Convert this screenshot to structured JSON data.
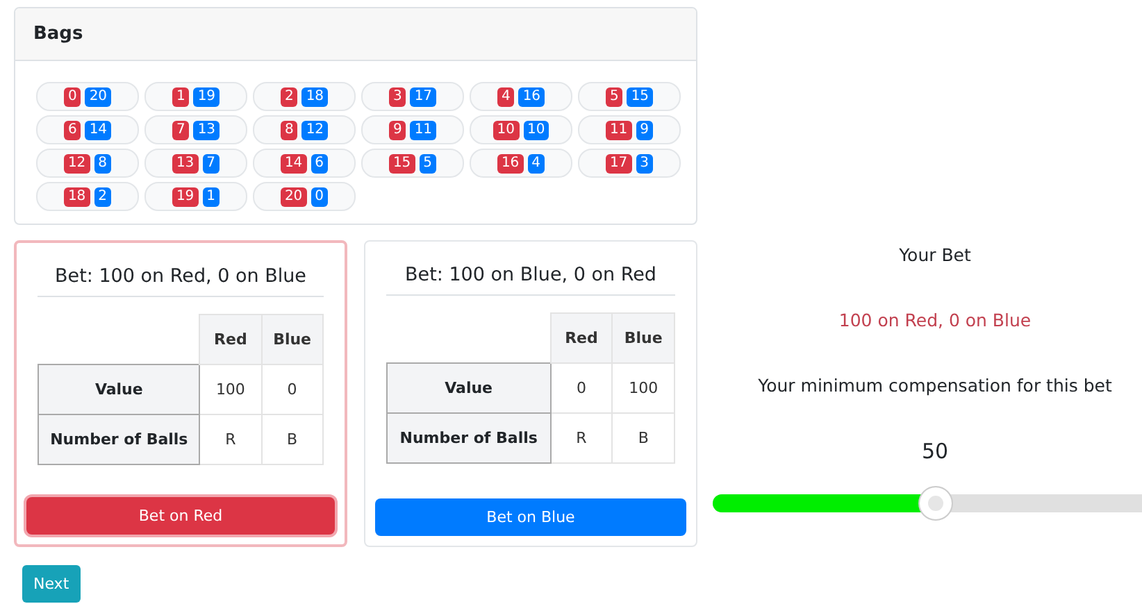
{
  "bags_panel": {
    "title": "Bags",
    "bags": [
      {
        "red": "0",
        "blue": "20"
      },
      {
        "red": "1",
        "blue": "19"
      },
      {
        "red": "2",
        "blue": "18"
      },
      {
        "red": "3",
        "blue": "17"
      },
      {
        "red": "4",
        "blue": "16"
      },
      {
        "red": "5",
        "blue": "15"
      },
      {
        "red": "6",
        "blue": "14"
      },
      {
        "red": "7",
        "blue": "13"
      },
      {
        "red": "8",
        "blue": "12"
      },
      {
        "red": "9",
        "blue": "11"
      },
      {
        "red": "10",
        "blue": "10"
      },
      {
        "red": "11",
        "blue": "9"
      },
      {
        "red": "12",
        "blue": "8"
      },
      {
        "red": "13",
        "blue": "7"
      },
      {
        "red": "14",
        "blue": "6"
      },
      {
        "red": "15",
        "blue": "5"
      },
      {
        "red": "16",
        "blue": "4"
      },
      {
        "red": "17",
        "blue": "3"
      },
      {
        "red": "18",
        "blue": "2"
      },
      {
        "red": "19",
        "blue": "1"
      },
      {
        "red": "20",
        "blue": "0"
      }
    ]
  },
  "bet_cards": [
    {
      "title": "Bet: 100 on Red, 0 on Blue",
      "selected": true,
      "columns": [
        "Red",
        "Blue"
      ],
      "rows": [
        {
          "label": "Value",
          "cells": [
            "100",
            "0"
          ]
        },
        {
          "label": "Number of Balls",
          "cells": [
            "R",
            "B"
          ]
        }
      ],
      "button": {
        "label": "Bet on Red",
        "kind": "red"
      }
    },
    {
      "title": "Bet: 100 on Blue, 0 on Red",
      "selected": false,
      "columns": [
        "Red",
        "Blue"
      ],
      "rows": [
        {
          "label": "Value",
          "cells": [
            "0",
            "100"
          ]
        },
        {
          "label": "Number of Balls",
          "cells": [
            "R",
            "B"
          ]
        }
      ],
      "button": {
        "label": "Bet on Blue",
        "kind": "blue"
      }
    }
  ],
  "your_bet": {
    "heading": "Your Bet",
    "bet": "100 on Red, 0 on Blue",
    "prompt": "Your minimum compensation for this bet",
    "value": "50",
    "slider": {
      "level": 0.5
    }
  },
  "next_button": "Next"
}
